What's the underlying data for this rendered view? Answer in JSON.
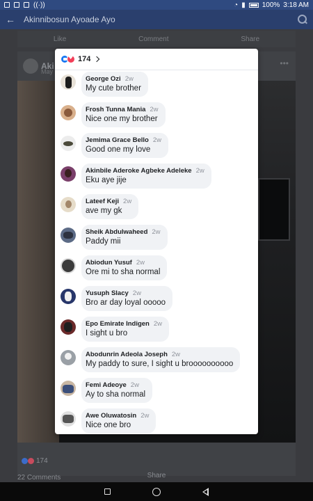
{
  "status_bar": {
    "battery": "100%",
    "time": "3:18 AM"
  },
  "top_bar": {
    "title": "Akinnibosun Ayoade Ayo"
  },
  "post": {
    "name_fragment": "Aki",
    "date_fragment": "May",
    "actions": {
      "like": "Like",
      "comment": "Comment",
      "share": "Share"
    },
    "reaction_count": "174",
    "comments_count": "22 Comments",
    "share_label": "Share"
  },
  "modal": {
    "reaction_count": "174",
    "comments": [
      {
        "name": "George Ozi",
        "time": "2w",
        "text": "My cute brother"
      },
      {
        "name": "Frosh Tunna Mania",
        "time": "2w",
        "text": "Nice one my brother"
      },
      {
        "name": "Jemima Grace Bello",
        "time": "2w",
        "text": "Good one my love"
      },
      {
        "name": "Akinbile Aderoke Agbeke Adeleke",
        "time": "2w",
        "text": "Eku aye jije"
      },
      {
        "name": "Lateef Keji",
        "time": "2w",
        "text": "ave my gk"
      },
      {
        "name": "Sheik Abdulwaheed",
        "time": "2w",
        "text": "Paddy mii"
      },
      {
        "name": "Abiodun Yusuf",
        "time": "2w",
        "text": "Ore mi to sha normal"
      },
      {
        "name": "Yusuph Slacy",
        "time": "2w",
        "text": "Bro ar day loyal ooooo"
      },
      {
        "name": "Epo Emirate Indigen",
        "time": "2w",
        "text": "I sight u bro"
      },
      {
        "name": "Abodunrin Adeola Joseph",
        "time": "2w",
        "text": "My paddy to sure, I sight u broooooooooo"
      },
      {
        "name": "Femi Adeoye",
        "time": "2w",
        "text": "Ay to sha normal"
      },
      {
        "name": "Awe Oluwatosin",
        "time": "2w",
        "text": "Nice one bro"
      }
    ]
  },
  "colors": {
    "like": "#1877f2",
    "love": "#f33e58",
    "bubble": "#f0f2f5",
    "header": "#2a3f6d"
  }
}
